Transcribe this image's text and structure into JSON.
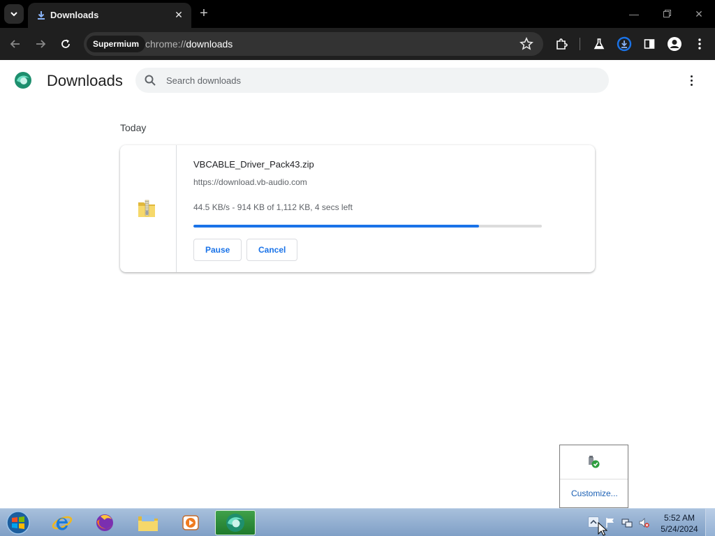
{
  "browser": {
    "tab_title": "Downloads",
    "site_chip": "Supermium",
    "url_scheme": "chrome://",
    "url_host": "downloads"
  },
  "page": {
    "title": "Downloads",
    "search_placeholder": "Search downloads",
    "section_label": "Today"
  },
  "downloads": [
    {
      "file_name": "VBCABLE_Driver_Pack43.zip",
      "url": "https://download.vb-audio.com",
      "status": "44.5 KB/s - 914 KB of 1,112 KB, 4 secs left",
      "progress_fraction": 0.82,
      "pause_label": "Pause",
      "cancel_label": "Cancel"
    }
  ],
  "tray_flyout": {
    "customize_label": "Customize..."
  },
  "taskbar": {
    "time": "5:52 AM",
    "date": "5/24/2024"
  },
  "colors": {
    "accent": "#1a73e8",
    "progress_track": "#dcdcdc",
    "tab_bar": "#000000",
    "toolbar": "#1f1f1f"
  }
}
